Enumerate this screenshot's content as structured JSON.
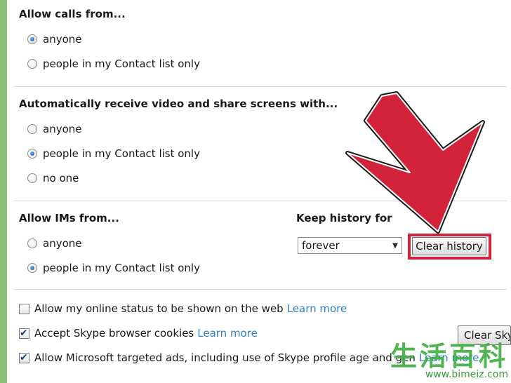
{
  "calls": {
    "heading": "Allow calls from...",
    "options": [
      "anyone",
      "people in my Contact list only"
    ]
  },
  "video": {
    "heading": "Automatically receive video and share screens with...",
    "options": [
      "anyone",
      "people in my Contact list only",
      "no one"
    ]
  },
  "ims": {
    "heading": "Allow IMs from...",
    "options": [
      "anyone",
      "people in my Contact list only"
    ]
  },
  "history": {
    "heading": "Keep history for",
    "selected": "forever",
    "clear_label": "Clear history"
  },
  "checkboxes": [
    {
      "label": "Allow my online status to be shown on the web",
      "link": "Learn more",
      "checked": false
    },
    {
      "label": "Accept Skype browser cookies",
      "link": "Learn more",
      "checked": true
    },
    {
      "label": "Allow Microsoft targeted ads, including use of Skype profile age and gen",
      "link": "Learn more",
      "checked": true
    }
  ],
  "side_button": "Clear Sky",
  "watermark": {
    "cn": "生活百科",
    "url": "www.bimeiz.com"
  },
  "colors": {
    "accent_red": "#d2233b",
    "link_blue": "#2f7fc1",
    "border_green": "#8cbf7a"
  }
}
